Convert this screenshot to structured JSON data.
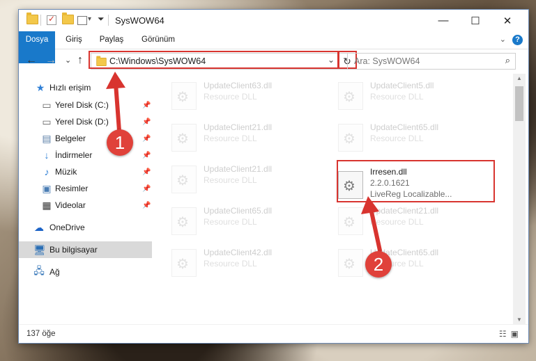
{
  "window": {
    "title": "SysWOW64",
    "minimize": "—",
    "maximize": "☐",
    "close": "✕"
  },
  "ribbon": {
    "tabs": [
      "Dosya",
      "Giriş",
      "Paylaş",
      "Görünüm"
    ],
    "help": "?",
    "collapse": "⌄"
  },
  "nav": {
    "back": "←",
    "forward": "→",
    "recent": "⌄",
    "up": "↑",
    "address": "C:\\Windows\\SysWOW64",
    "address_dropdown": "⌄",
    "refresh": "↻",
    "search_placeholder": "Ara: SysWOW64",
    "search_icon": "⌕"
  },
  "sidebar": {
    "quick_access": "Hızlı erişim",
    "items": [
      {
        "label": "Yerel Disk (C:)",
        "icon": "drive-icon"
      },
      {
        "label": "Yerel Disk (D:)",
        "icon": "drive-icon"
      },
      {
        "label": "Belgeler",
        "icon": "documents-icon"
      },
      {
        "label": "İndirmeler",
        "icon": "downloads-icon"
      },
      {
        "label": "Müzik",
        "icon": "music-icon"
      },
      {
        "label": "Resimler",
        "icon": "pictures-icon"
      },
      {
        "label": "Videolar",
        "icon": "videos-icon"
      }
    ],
    "onedrive": "OneDrive",
    "this_pc": "Bu bilgisayar",
    "network": "Ağ"
  },
  "files": {
    "left": [
      {
        "name": "UpdateClient63.dll",
        "desc": "Resource DLL"
      },
      {
        "name": "UpdateClient21.dll",
        "desc": "Resource DLL"
      },
      {
        "name": "UpdateClient21.dll",
        "desc": "Resource DLL"
      },
      {
        "name": "UpdateClient65.dll",
        "desc": "Resource DLL"
      },
      {
        "name": "UpdateClient42.dll",
        "desc": "Resource DLL"
      }
    ],
    "right": [
      {
        "name": "UpdateClient5.dll",
        "desc": "Resource DLL"
      },
      {
        "name": "UpdateClient65.dll",
        "desc": "Resource DLL"
      },
      {
        "name": "UpdateClient21.dll",
        "desc": "Resource DLL"
      },
      {
        "name": "UpdateClient65.dll",
        "desc": "Resource DLL"
      }
    ],
    "highlighted": {
      "name": "Irresen.dll",
      "version": "2.2.0.1621",
      "desc": "LiveReg Localizable..."
    }
  },
  "status": {
    "count": "137 öğe"
  },
  "annotations": {
    "step1": "1",
    "step2": "2",
    "color": "#d8342f"
  }
}
